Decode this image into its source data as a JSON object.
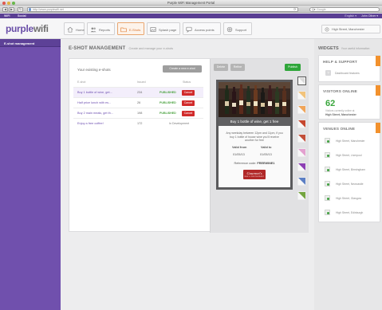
{
  "window": {
    "title": "Purple WiFi Management Portal"
  },
  "browser": {
    "url": "http://www.purplewifi.net",
    "search_placeholder": "Google",
    "search_prefix": "Q▾",
    "back_icon": "◀",
    "forward_icon": "▶",
    "reload_icon": "↻"
  },
  "bookmarks": {
    "items": [
      "WiFi",
      "Social"
    ],
    "language": "English ▾",
    "user": "John Oliver ▾"
  },
  "brand": {
    "logo_part1": "purple",
    "logo_part2": "wifi",
    "color": "#6a4fa8",
    "accent": "#d9742f"
  },
  "nav": {
    "tabs": [
      {
        "label": "Home",
        "icon": "home-icon"
      },
      {
        "label": "Reports",
        "icon": "users-icon"
      },
      {
        "label": "E-Shots",
        "icon": "folder-icon",
        "active": true
      },
      {
        "label": "Splash page",
        "icon": "image-icon"
      },
      {
        "label": "Access points",
        "icon": "chat-icon"
      },
      {
        "label": "Support",
        "icon": "support-icon"
      }
    ],
    "venue_select": "High Street, Manchester"
  },
  "sidebar": {
    "items": [
      {
        "label": "E-shot management"
      }
    ]
  },
  "main": {
    "title": "E-SHOT MANAGEMENT",
    "subtitle": "Create and manage your e-shots",
    "list": {
      "title": "Your existing e-shots",
      "create_label": "Create a new e-shot",
      "headers": {
        "name": "E-shot",
        "issued": "Issued",
        "status": "Status"
      },
      "rows": [
        {
          "name": "Buy 1 bottle of wine, get...",
          "issued": "234",
          "status": "PUBLISHED",
          "action": "Cancel"
        },
        {
          "name": "Half price lunch with es...",
          "issued": "26",
          "status": "PUBLISHED",
          "action": "Cancel"
        },
        {
          "name": "Buy 2 main meals, get th...",
          "issued": "198",
          "status": "PUBLISHED",
          "action": "Cancel"
        },
        {
          "name": "Enjoy a free coffee!",
          "issued": "172",
          "status": "In Development"
        }
      ]
    },
    "preview": {
      "delete_label": "Delete",
      "refine_label": "Refine",
      "publish_label": "Publish",
      "headline": "Buy 1 bottle of wine, get 1 free",
      "description": "Any weekday between 12pm and 11pm, if you buy 1 bottle of house wine you'll receive another for free",
      "valid_from_label": "Valid from",
      "valid_to_label": "Valid to",
      "valid_from": "01/05/13",
      "valid_to": "01/05/13",
      "reference_label": "Reference code:",
      "reference_code": "FREEWINE1",
      "logo_name": "Gourmet's",
      "logo_tagline": "BAR & RESTAURANT",
      "swatches": [
        "#d9d9d9",
        "#f2c37b",
        "#f0a458",
        "#c6472f",
        "#c24f3a",
        "#e3a0cf",
        "#8d3fb4",
        "#5c7fc4",
        "#74a53f"
      ]
    }
  },
  "widgets": {
    "title": "WIDGETS",
    "subtitle": "Your useful information",
    "help": {
      "title": "HELP & SUPPORT",
      "item": "Dashboard features",
      "icon_glyph": "?"
    },
    "visitors": {
      "title": "VISITORS ONLINE",
      "count": "62",
      "sub": "Visitors currently online at",
      "venue": "High Street, Manchester"
    },
    "venues": {
      "title": "VENUES ONLINE",
      "items": [
        "High Street, Manchester",
        "High Street, Liverpool",
        "High Street, Birmingham",
        "High Street, Newcastle",
        "High Street, Glasgow",
        "High Street, Edinburgh"
      ]
    },
    "accent": "#f2912d"
  }
}
